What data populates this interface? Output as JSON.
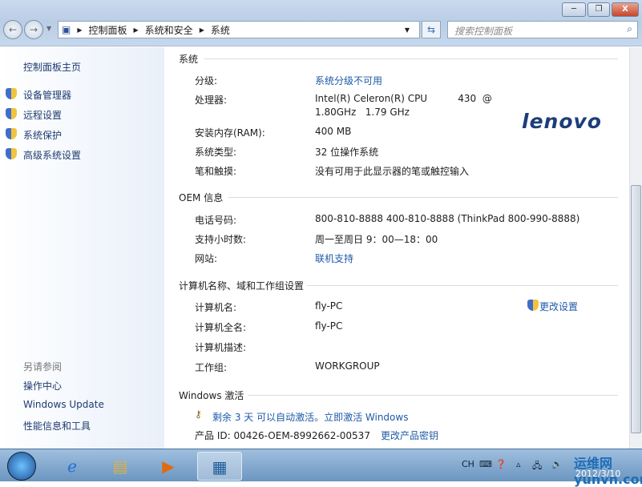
{
  "window": {
    "minimize": "─",
    "restore": "❐",
    "close": "X"
  },
  "address": {
    "breadcrumbs": [
      "控制面板",
      "系统和安全",
      "系统"
    ],
    "search_placeholder": "搜索控制面板"
  },
  "sidebar": {
    "home": "控制面板主页",
    "items": [
      "设备管理器",
      "远程设置",
      "系统保护",
      "高级系统设置"
    ],
    "see_also": "另请参阅",
    "see_also_items": [
      "操作中心",
      "Windows Update",
      "性能信息和工具"
    ]
  },
  "system": {
    "heading": "系统",
    "rows": [
      {
        "label": "分级:",
        "value": "系统分级不可用"
      },
      {
        "label": "处理器:",
        "value": "Intel(R) Celeron(R) CPU          430  @",
        "value2": "1.80GHz   1.79 GHz"
      },
      {
        "label": "安装内存(RAM):",
        "value": "400 MB"
      },
      {
        "label": "系统类型:",
        "value": "32 位操作系统"
      },
      {
        "label": "笔和触摸:",
        "value": "没有可用于此显示器的笔或触控输入"
      }
    ],
    "logo": "lenovo"
  },
  "oem": {
    "heading": "OEM 信息",
    "rows": [
      {
        "label": "电话号码:",
        "value": "800-810-8888 400-810-8888 (ThinkPad 800-990-8888)"
      },
      {
        "label": "支持小时数:",
        "value": "周一至周日 9：00—18：00"
      },
      {
        "label": "网站:",
        "value": "联机支持"
      }
    ]
  },
  "computer": {
    "heading": "计算机名称、域和工作组设置",
    "change": "更改设置",
    "rows": [
      {
        "label": "计算机名:",
        "value": "fly-PC"
      },
      {
        "label": "计算机全名:",
        "value": "fly-PC"
      },
      {
        "label": "计算机描述:",
        "value": ""
      },
      {
        "label": "工作组:",
        "value": "WORKGROUP"
      }
    ]
  },
  "activation": {
    "heading": "Windows 激活",
    "message": "剩余 3 天 可以自动激活。立即激活 Windows",
    "product_id": "产品 ID: 00426-OEM-8992662-00537",
    "change_key": "更改产品密钥"
  },
  "taskbar": {
    "lang": "CH",
    "date": "2012/3/10",
    "watermark": "运维网 yunvn.com"
  }
}
